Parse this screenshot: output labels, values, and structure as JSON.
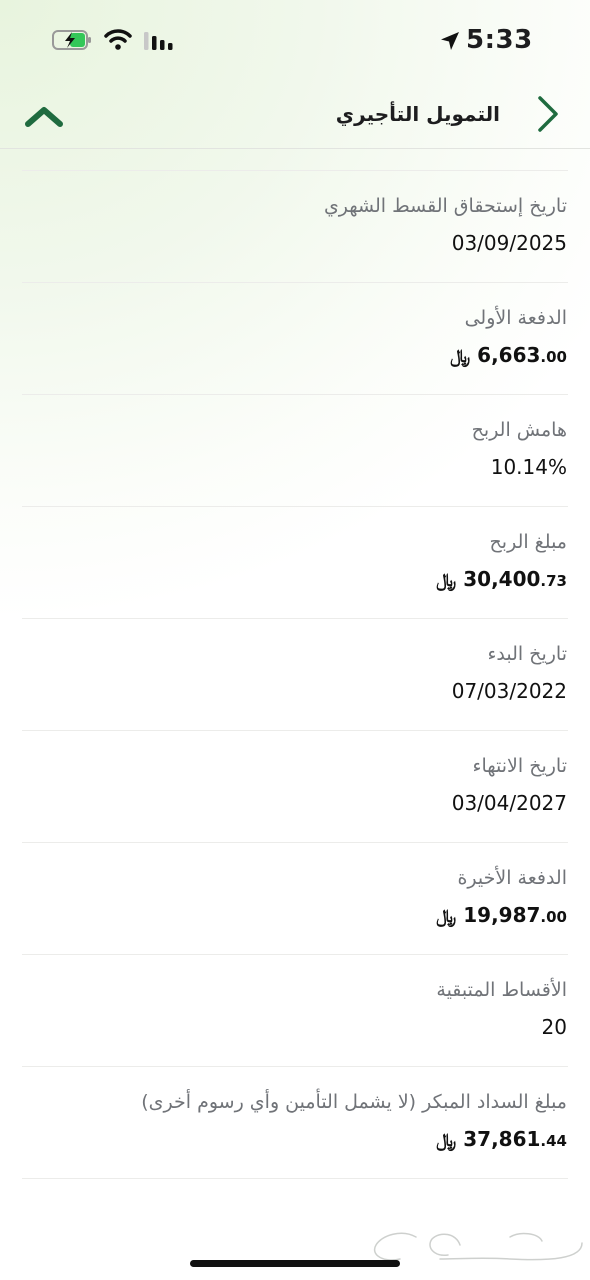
{
  "status_bar": {
    "time": "5:33",
    "battery_icon": "battery-charging-icon",
    "wifi_icon": "wifi-icon",
    "cellular_icon": "cellular-signal-icon",
    "location_icon": "location-arrow-icon"
  },
  "nav": {
    "title": "التمويل التأجيري",
    "back_icon": "chevron-right-icon",
    "collapse_icon": "chevron-up-icon",
    "accent_color": "#1f6b3f"
  },
  "details": [
    {
      "label": "تاريخ إستحقاق القسط الشهري",
      "value": "03/09/2025"
    },
    {
      "label": "الدفعة الأولى",
      "currency": "﷼",
      "int": "6,663",
      "dec": ".00"
    },
    {
      "label": "هامش الربح",
      "value": "10.14%"
    },
    {
      "label": "مبلغ الربح",
      "currency": "﷼",
      "int": "30,400",
      "dec": ".73"
    },
    {
      "label": "تاريخ البدء",
      "value": "07/03/2022"
    },
    {
      "label": "تاريخ الانتهاء",
      "value": "03/04/2027"
    },
    {
      "label": "الدفعة الأخيرة",
      "currency": "﷼",
      "int": "19,987",
      "dec": ".00"
    },
    {
      "label": "الأقساط المتبقية",
      "value": "20"
    },
    {
      "label": "مبلغ السداد المبكر (لا يشمل التأمين وأي رسوم أخرى)",
      "currency": "﷼",
      "int": "37,861",
      "dec": ".44"
    }
  ],
  "watermark": {
    "text": "حراج"
  }
}
